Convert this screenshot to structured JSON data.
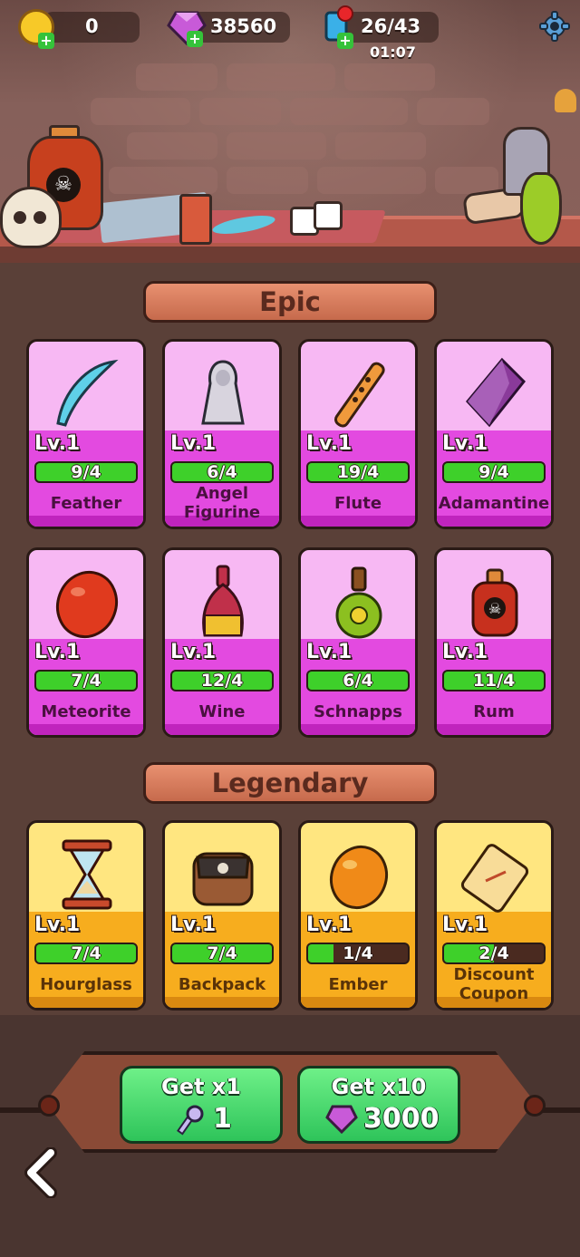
{
  "hud": {
    "coins": "0",
    "gems": "38560",
    "keys": "26/43",
    "key_timer": "01:07"
  },
  "sections": {
    "epic_title": "Epic",
    "legendary_title": "Legendary"
  },
  "epic_items": [
    {
      "name": "Feather",
      "level": "Lv.1",
      "progress": "9/4",
      "fill": 1.0
    },
    {
      "name": "Angel Figurine",
      "level": "Lv.1",
      "progress": "6/4",
      "fill": 1.0
    },
    {
      "name": "Flute",
      "level": "Lv.1",
      "progress": "19/4",
      "fill": 1.0
    },
    {
      "name": "Adamantine",
      "level": "Lv.1",
      "progress": "9/4",
      "fill": 1.0
    },
    {
      "name": "Meteorite",
      "level": "Lv.1",
      "progress": "7/4",
      "fill": 1.0
    },
    {
      "name": "Wine",
      "level": "Lv.1",
      "progress": "12/4",
      "fill": 1.0
    },
    {
      "name": "Schnapps",
      "level": "Lv.1",
      "progress": "6/4",
      "fill": 1.0
    },
    {
      "name": "Rum",
      "level": "Lv.1",
      "progress": "11/4",
      "fill": 1.0
    }
  ],
  "legendary_items": [
    {
      "name": "Hourglass",
      "level": "Lv.1",
      "progress": "7/4",
      "fill": 1.0
    },
    {
      "name": "Backpack",
      "level": "Lv.1",
      "progress": "7/4",
      "fill": 1.0
    },
    {
      "name": "Ember",
      "level": "Lv.1",
      "progress": "1/4",
      "fill": 0.25
    },
    {
      "name": "Discount Coupon",
      "level": "Lv.1",
      "progress": "2/4",
      "fill": 0.5
    }
  ],
  "buttons": {
    "get_x1_label": "Get x1",
    "get_x1_cost": "1",
    "get_x10_label": "Get x10",
    "get_x10_cost": "3000"
  },
  "colors": {
    "epic_card": "#f7b8f3",
    "legendary_card": "#ffe680",
    "progress_fill": "#3ed02a",
    "button_green": "#2ec45a"
  }
}
